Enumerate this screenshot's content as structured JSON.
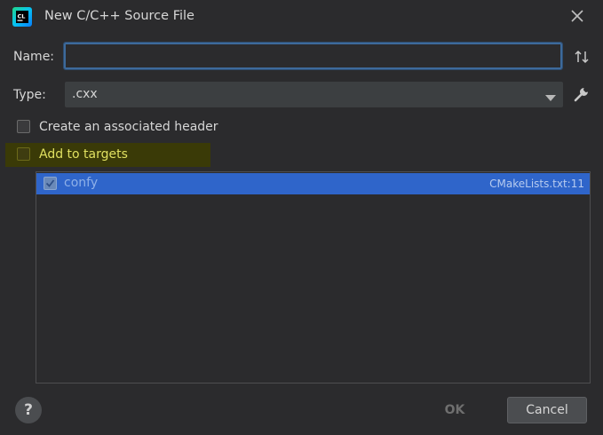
{
  "dialog": {
    "title": "New C/C++ Source File",
    "app_icon": "clion-icon"
  },
  "name_field": {
    "label": "Name:",
    "value": "",
    "placeholder": ""
  },
  "type_field": {
    "label": "Type:",
    "selected": ".cxx"
  },
  "options": {
    "create_header_label": "Create an associated header",
    "create_header_checked": false,
    "add_to_targets_label": "Add to targets",
    "add_to_targets_checked": false
  },
  "targets": [
    {
      "name": "confy",
      "source": "CMakeLists.txt:11",
      "checked": true
    }
  ],
  "buttons": {
    "help": "?",
    "ok": "OK",
    "cancel": "Cancel"
  },
  "colors": {
    "background": "#2b2b2d",
    "selection": "#2f65ca",
    "highlight": "#3a3a07",
    "input_border": "#3d6a9b"
  }
}
